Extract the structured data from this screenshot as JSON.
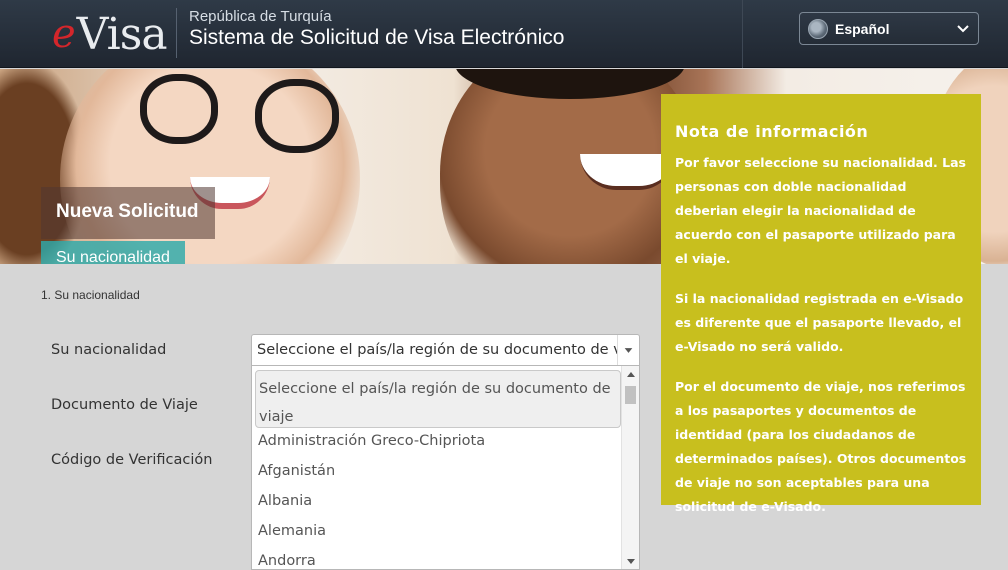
{
  "header": {
    "logo_e": "e",
    "logo_visa": "Visa",
    "subtitle": "República de Turquía",
    "title": "Sistema de Solicitud de Visa Electrónico",
    "language": {
      "label": "Español",
      "icon": "globe-icon"
    }
  },
  "banner": {
    "new_application": "Nueva Solicitud",
    "current_step": "Su nacionalidad"
  },
  "info_note": {
    "title": "Nota de información",
    "paragraphs": [
      "Por favor seleccione su nacionalidad. Las personas con doble nacionalidad deberian elegir la nacionalidad de acuerdo con el pasaporte utilizado para el viaje.",
      "Si la nacionalidad registrada en e-Visado es diferente que el pasaporte llevado, el e-Visado no será valido.",
      "Por el documento de viaje, nos referimos a los pasaportes y documentos de identidad (para los ciudadanos de determinados países). Otros documentos de viaje no son aceptables para una solicitud de e-Visado."
    ]
  },
  "form": {
    "step_label": "1. Su nacionalidad",
    "nationality_label": "Su nacionalidad",
    "travel_document_label": "Documento de Viaje",
    "verification_code_label": "Código de Verificación",
    "nationality_select": {
      "selected": "Seleccione el país/la región de su documento de viaje",
      "options": [
        "Seleccione el país/la región de su documento de viaje",
        "Administración Greco-Chipriota",
        "Afganistán",
        "Albania",
        "Alemania",
        "Andorra"
      ]
    }
  },
  "colors": {
    "header_bg": "#262e39",
    "info_bg": "#c8bf1e",
    "step_tag": "#2eaaaa",
    "logo_red": "#d4262b"
  }
}
